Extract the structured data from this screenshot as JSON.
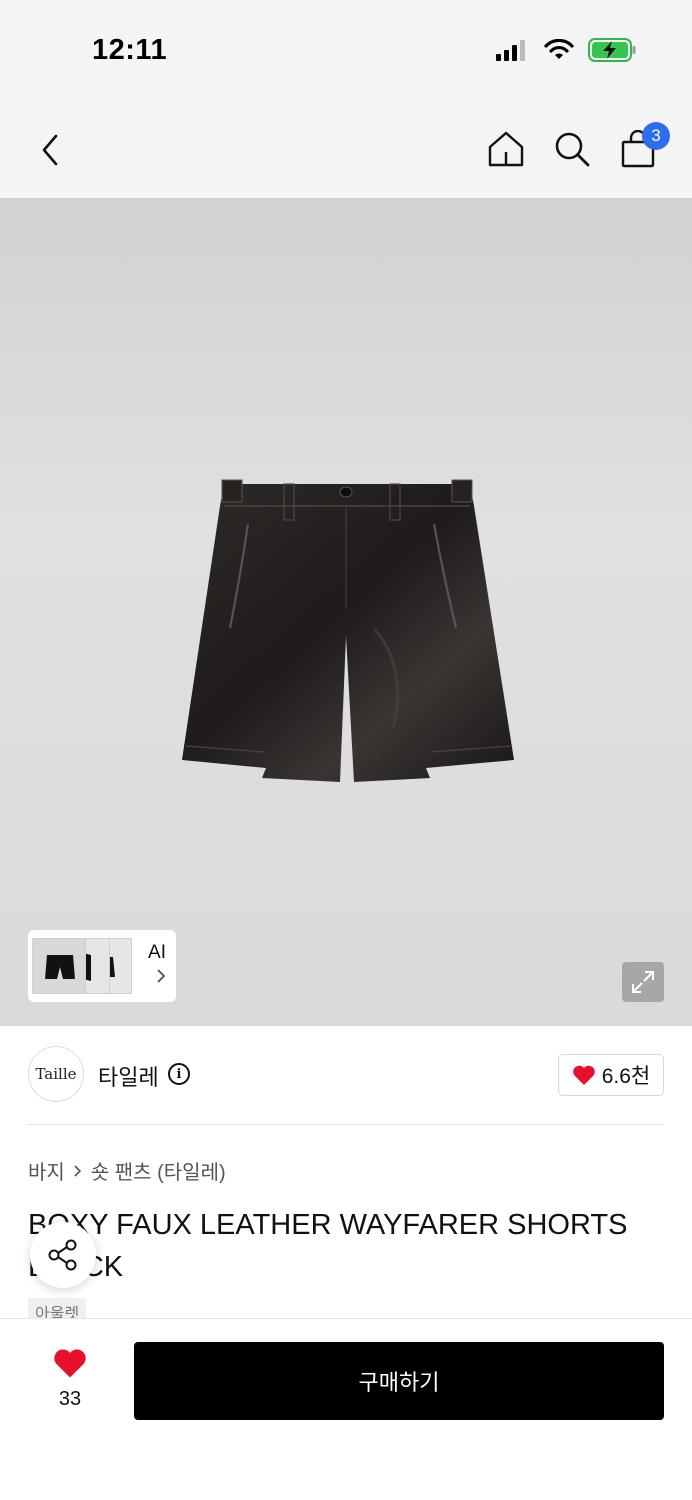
{
  "status_bar": {
    "time": "12:11"
  },
  "nav": {
    "cart_count": "3"
  },
  "gallery": {
    "ai_label": "AI"
  },
  "brand": {
    "logo_text": "Taille",
    "name": "타일레",
    "likes": "6.6천"
  },
  "product": {
    "breadcrumb": [
      "바지",
      "숏 팬츠 (타일레)"
    ],
    "title": "BOXY FAUX LEATHER WAYFARER SHORTS BLACK",
    "tag": "아울렛"
  },
  "bottom": {
    "wish_count": "33",
    "buy_label": "구매하기"
  },
  "colors": {
    "accent": "#2f6df0",
    "heart": "#e8112d",
    "buy_button": "#000000"
  }
}
